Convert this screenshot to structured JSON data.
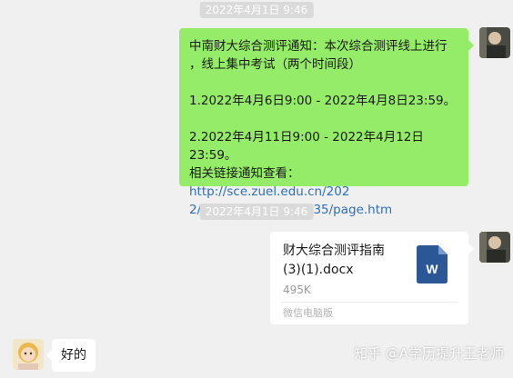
{
  "chat": {
    "timestamp_1": "2022年4月1日 9:46",
    "timestamp_2": "2022年4月1日 9:46",
    "message_1": {
      "line_1": "中南财大综合测评通知：本次综合测评线上进行",
      "line_2": "，线上集中考试（两个时间段）",
      "line_3": "1.2022年4月6日9:00 - 2022年4月8日23:59。",
      "line_4": "2.2022年4月11日9:00 - 2022年4月12日23:59。",
      "line_5_prefix": "相关链接通知查看：",
      "link_part_1": "http://sce.zuel.edu.cn/202",
      "link_part_2": "2/0331/c2958a295035/page.htm"
    },
    "file_message": {
      "name_line_1": "财大综合测评指南",
      "name_line_2": "(3)(1).docx",
      "size": "495K",
      "source": "微信电脑版",
      "icon_letter": "W",
      "icon": "word-document-icon"
    },
    "reply": {
      "text": "好的"
    }
  },
  "watermark": {
    "text": "知乎 @A学历提升王老师"
  },
  "colors": {
    "background": "#f0f0f0",
    "sent_bubble": "#95ec69",
    "received_bubble": "#ffffff",
    "link": "#2f6fb5",
    "word_blue": "#2b5797"
  }
}
